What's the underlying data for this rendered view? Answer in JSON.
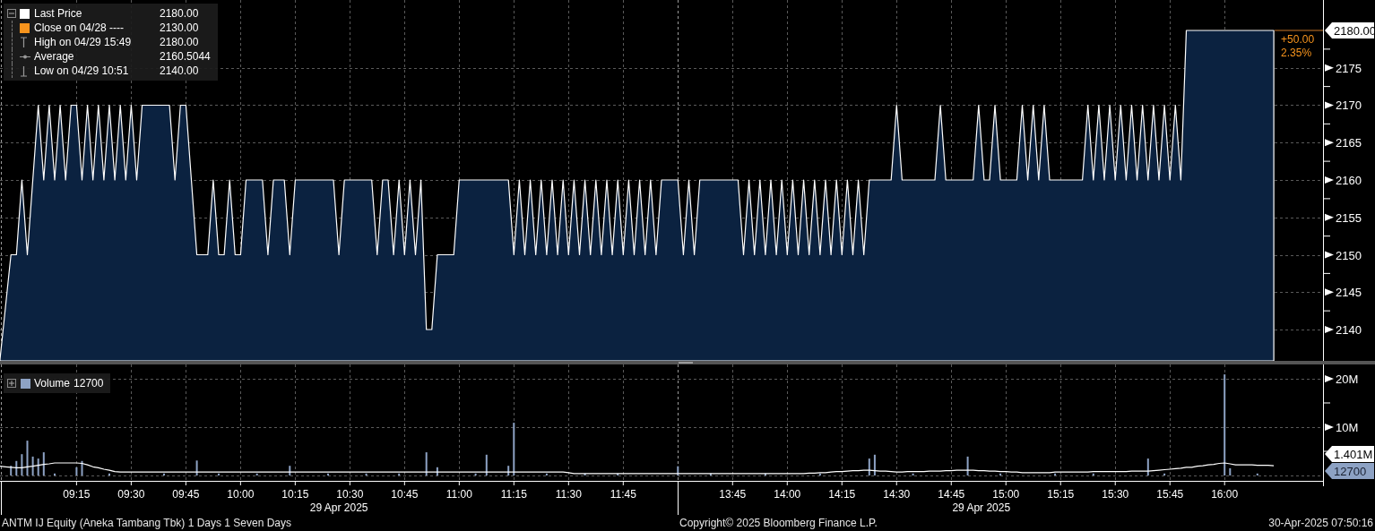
{
  "price_chart": {
    "legend": {
      "items": [
        {
          "kind": "swatch",
          "label": "Last Price",
          "value": "2180.00",
          "color": "#ffffff"
        },
        {
          "kind": "swatch",
          "label": "Close on 04/28 ----",
          "value": "2130.00",
          "color": "#f7941d"
        },
        {
          "kind": "high",
          "label": "High on 04/29 15:49",
          "value": "2180.00"
        },
        {
          "kind": "average",
          "label": "Average",
          "value": "2160.5044"
        },
        {
          "kind": "low",
          "label": "Low on 04/29 10:51",
          "value": "2140.00"
        }
      ]
    },
    "last_price_flag": "2180.00",
    "change": "+50.00",
    "change_percent": "2.35%",
    "chart_data": {
      "type": "area",
      "grid": true,
      "ylim": [
        2135.81,
        2184.07
      ],
      "yticks": [
        2140,
        2145,
        2150,
        2155,
        2160,
        2165,
        2170,
        2175
      ],
      "categories": [
        null,
        null,
        null,
        null,
        null,
        null,
        null,
        null,
        null,
        null,
        null,
        null,
        null,
        null,
        null,
        null,
        null,
        null,
        null,
        null,
        null,
        null,
        null,
        null,
        null,
        null,
        null,
        null,
        null,
        null,
        null,
        null,
        null,
        null,
        null,
        null,
        null,
        null,
        null,
        null,
        null,
        null,
        null,
        null,
        null,
        null,
        null,
        null,
        null,
        null,
        null,
        null,
        null,
        null,
        null,
        null,
        null,
        null,
        null,
        null,
        null,
        null,
        null,
        null,
        null,
        null,
        null,
        null,
        null,
        null,
        null,
        null,
        null,
        null,
        null,
        null,
        null,
        null,
        null,
        null,
        null,
        null,
        null,
        null,
        null,
        null,
        null,
        null,
        null,
        null,
        null,
        null,
        null,
        null,
        null,
        null,
        null,
        null,
        null,
        null,
        null,
        null,
        null,
        null,
        null,
        null,
        null,
        null,
        null,
        null,
        null,
        null,
        null,
        null,
        null,
        null,
        null,
        null,
        null,
        null,
        null,
        null,
        null,
        null,
        null,
        null,
        null,
        null,
        null,
        null,
        null,
        null,
        null,
        null,
        null,
        null,
        null,
        null,
        null,
        null,
        null,
        null,
        null,
        null,
        null,
        null,
        null,
        null,
        null,
        null,
        null,
        null,
        null,
        null,
        null,
        null,
        null,
        null,
        null,
        null,
        null,
        null,
        null,
        null,
        null,
        null,
        null,
        null,
        null,
        null,
        null,
        null,
        null,
        null,
        null,
        null,
        null,
        null,
        null,
        null,
        null,
        null,
        null,
        null,
        null,
        null,
        null,
        null,
        null,
        null,
        null,
        null,
        null,
        null,
        null,
        null,
        null,
        null,
        null,
        null,
        null,
        null,
        null,
        null,
        null,
        null,
        null,
        null,
        null,
        null,
        null,
        null,
        null,
        null,
        null,
        null,
        null,
        null,
        null,
        null,
        null,
        null,
        null,
        null,
        null,
        null,
        null,
        null,
        null,
        null,
        null,
        null,
        null,
        null
      ],
      "series": [
        {
          "values": [
            2136,
            2143,
            2150,
            2150,
            2160,
            2150,
            2160,
            2170,
            2160,
            2170,
            2160,
            2170,
            2160,
            2170,
            2170,
            2160,
            2170,
            2160,
            2170,
            2160,
            2170,
            2160,
            2170,
            2160,
            2170,
            2160,
            2170,
            2170,
            2170,
            2170,
            2170,
            2170,
            2160,
            2170,
            2170,
            2160,
            2150,
            2150,
            2150,
            2160,
            2150,
            2150,
            2160,
            2150,
            2150,
            2160,
            2160,
            2160,
            2160,
            2150,
            2160,
            2160,
            2160,
            2150,
            2160,
            2160,
            2160,
            2160,
            2160,
            2160,
            2160,
            2160,
            2150,
            2160,
            2160,
            2160,
            2160,
            2160,
            2160,
            2150,
            2160,
            2160,
            2150,
            2160,
            2150,
            2160,
            2150,
            2160,
            2140,
            2140,
            2150,
            2150,
            2150,
            2150,
            2160,
            2160,
            2160,
            2160,
            2160,
            2160,
            2160,
            2160,
            2160,
            2160,
            2150,
            2160,
            2150,
            2160,
            2150,
            2160,
            2150,
            2160,
            2150,
            2160,
            2150,
            2160,
            2150,
            2160,
            2150,
            2160,
            2150,
            2160,
            2150,
            2160,
            2150,
            2160,
            2150,
            2160,
            2150,
            2160,
            2150,
            2160,
            2160,
            2160,
            2160,
            2150,
            2160,
            2150,
            2160,
            2160,
            2160,
            2160,
            2160,
            2160,
            2160,
            2160,
            2150,
            2160,
            2150,
            2160,
            2150,
            2160,
            2150,
            2160,
            2150,
            2160,
            2150,
            2160,
            2150,
            2160,
            2150,
            2160,
            2150,
            2160,
            2150,
            2160,
            2150,
            2160,
            2150,
            2160,
            2160,
            2160,
            2160,
            2160,
            2170,
            2160,
            2160,
            2160,
            2160,
            2160,
            2160,
            2160,
            2170,
            2160,
            2160,
            2160,
            2160,
            2160,
            2160,
            2170,
            2160,
            2160,
            2170,
            2160,
            2160,
            2160,
            2160,
            2170,
            2160,
            2170,
            2160,
            2170,
            2160,
            2160,
            2160,
            2160,
            2160,
            2160,
            2160,
            2170,
            2160,
            2170,
            2160,
            2170,
            2160,
            2170,
            2160,
            2170,
            2160,
            2170,
            2160,
            2170,
            2160,
            2170,
            2160,
            2170,
            2160,
            2180,
            2180,
            2180,
            2180,
            2180,
            2180,
            2180,
            2180,
            2180,
            2180,
            2180,
            2180,
            2180,
            2180,
            2180,
            2180,
            2180
          ]
        }
      ]
    }
  },
  "volume_chart": {
    "legend": {
      "label": "Volume",
      "value": "12700",
      "color": "#8da2c4"
    },
    "flags": [
      {
        "kind": "average",
        "text": "1.401M"
      },
      {
        "kind": "last",
        "text": "12700"
      }
    ],
    "chart_data": {
      "type": "bar",
      "grid": true,
      "ylim": [
        -1110000,
        22960000
      ],
      "yticks": [
        {
          "value": 10000000,
          "label": "10M"
        },
        {
          "value": 20000000,
          "label": "20M"
        }
      ],
      "categories": [
        null,
        null,
        null,
        null,
        null,
        null,
        null,
        null,
        null,
        null,
        null,
        null,
        null,
        null,
        "09:15",
        null,
        null,
        null,
        null,
        null,
        null,
        null,
        null,
        null,
        "09:30",
        null,
        null,
        null,
        null,
        null,
        null,
        null,
        null,
        null,
        "09:45",
        null,
        null,
        null,
        null,
        null,
        null,
        null,
        null,
        null,
        "10:00",
        null,
        null,
        null,
        null,
        null,
        null,
        null,
        null,
        null,
        "10:15",
        null,
        null,
        null,
        null,
        null,
        null,
        null,
        null,
        null,
        "10:30",
        null,
        null,
        null,
        null,
        null,
        null,
        null,
        null,
        null,
        "10:45",
        null,
        null,
        null,
        null,
        null,
        null,
        null,
        null,
        null,
        "11:00",
        null,
        null,
        null,
        null,
        null,
        null,
        null,
        null,
        null,
        "11:15",
        null,
        null,
        null,
        null,
        null,
        null,
        null,
        null,
        null,
        "11:30",
        null,
        null,
        null,
        null,
        null,
        null,
        null,
        null,
        null,
        "11:45",
        null,
        null,
        null,
        null,
        null,
        null,
        null,
        null,
        null,
        null,
        null,
        null,
        null,
        null,
        null,
        null,
        null,
        null,
        null,
        "13:45",
        null,
        null,
        null,
        null,
        null,
        null,
        null,
        null,
        null,
        "14:00",
        null,
        null,
        null,
        null,
        null,
        null,
        null,
        null,
        null,
        "14:15",
        null,
        null,
        null,
        null,
        null,
        null,
        null,
        null,
        null,
        "14:30",
        null,
        null,
        null,
        null,
        null,
        null,
        null,
        null,
        null,
        "14:45",
        null,
        null,
        null,
        null,
        null,
        null,
        null,
        null,
        null,
        "15:00",
        null,
        null,
        null,
        null,
        null,
        null,
        null,
        null,
        null,
        "15:15",
        null,
        null,
        null,
        null,
        null,
        null,
        null,
        null,
        null,
        "15:30",
        null,
        null,
        null,
        null,
        null,
        null,
        null,
        null,
        null,
        "15:45",
        null,
        null,
        null,
        null,
        null,
        null,
        null,
        null,
        null,
        "16:00",
        null,
        null,
        null,
        null,
        null,
        null,
        null,
        null,
        null
      ],
      "series": [
        {
          "color": "#8da2c4",
          "values": [
            null,
            null,
            2000000,
            3000000,
            4400000,
            7200000,
            3900000,
            3500000,
            4800000,
            null,
            400000,
            null,
            null,
            null,
            1700000,
            3000000,
            null,
            null,
            null,
            null,
            400000,
            null,
            null,
            null,
            null,
            null,
            null,
            null,
            null,
            null,
            400000,
            null,
            null,
            null,
            null,
            null,
            3100000,
            null,
            null,
            null,
            400000,
            null,
            null,
            null,
            null,
            null,
            null,
            400000,
            null,
            null,
            null,
            null,
            null,
            2000000,
            null,
            null,
            null,
            null,
            null,
            null,
            400000,
            null,
            null,
            null,
            null,
            null,
            null,
            400000,
            null,
            null,
            null,
            null,
            null,
            400000,
            null,
            null,
            null,
            null,
            4800000,
            null,
            1700000,
            null,
            null,
            null,
            null,
            null,
            null,
            400000,
            null,
            4300000,
            null,
            null,
            null,
            2000000,
            10900000,
            null,
            null,
            null,
            null,
            null,
            400000,
            null,
            null,
            null,
            null,
            null,
            null,
            400000,
            null,
            null,
            null,
            null,
            null,
            400000,
            null,
            null,
            null,
            null,
            null,
            null,
            null,
            null,
            null,
            null,
            1900000,
            null,
            null,
            null,
            null,
            null,
            400000,
            null,
            null,
            null,
            null,
            null,
            null,
            null,
            null,
            null,
            400000,
            null,
            null,
            null,
            null,
            null,
            null,
            null,
            null,
            null,
            400000,
            null,
            null,
            null,
            null,
            null,
            null,
            null,
            null,
            3500000,
            4300000,
            null,
            null,
            null,
            null,
            null,
            null,
            400000,
            null,
            null,
            null,
            null,
            null,
            null,
            null,
            null,
            null,
            3900000,
            null,
            null,
            null,
            null,
            null,
            400000,
            null,
            null,
            null,
            null,
            null,
            null,
            null,
            null,
            null,
            400000,
            null,
            null,
            null,
            null,
            null,
            null,
            400000,
            null,
            null,
            null,
            null,
            null,
            null,
            null,
            null,
            null,
            3500000,
            null,
            null,
            400000,
            null,
            null,
            null,
            null,
            null,
            null,
            null,
            null,
            null,
            null,
            20900000,
            1500000,
            null,
            null,
            null,
            null,
            400000,
            null,
            null,
            null
          ]
        },
        {
          "type": "line",
          "color": "#ffffff",
          "values": [
            1900000,
            1800000,
            1700000,
            1600000,
            1600000,
            1800000,
            1900000,
            2100000,
            2300000,
            2400000,
            2600000,
            2600000,
            2600000,
            2600000,
            2600000,
            2500000,
            2200000,
            1800000,
            1600000,
            1300000,
            1100000,
            800000,
            700000,
            700000,
            700000,
            700000,
            700000,
            700000,
            700000,
            700000,
            700000,
            700000,
            700000,
            700000,
            700000,
            700000,
            700000,
            700000,
            700000,
            700000,
            700000,
            700000,
            700000,
            700000,
            700000,
            700000,
            700000,
            700000,
            700000,
            700000,
            700000,
            700000,
            700000,
            700000,
            700000,
            700000,
            700000,
            700000,
            700000,
            700000,
            700000,
            700000,
            700000,
            700000,
            700000,
            700000,
            700000,
            700000,
            700000,
            700000,
            700000,
            700000,
            700000,
            700000,
            700000,
            700000,
            700000,
            700000,
            700000,
            700000,
            700000,
            700000,
            700000,
            700000,
            700000,
            700000,
            700000,
            700000,
            700000,
            700000,
            700000,
            700000,
            700000,
            700000,
            700000,
            700000,
            700000,
            700000,
            700000,
            700000,
            700000,
            700000,
            700000,
            700000,
            600000,
            400000,
            400000,
            400000,
            400000,
            400000,
            400000,
            400000,
            400000,
            400000,
            400000,
            400000,
            400000,
            400000,
            400000,
            400000,
            400000,
            400000,
            400000,
            400000,
            400000,
            400000,
            400000,
            400000,
            400000,
            400000,
            400000,
            400000,
            400000,
            400000,
            400000,
            400000,
            400000,
            400000,
            400000,
            400000,
            400000,
            400000,
            400000,
            400000,
            400000,
            400000,
            400000,
            400000,
            500000,
            500000,
            600000,
            600000,
            700000,
            800000,
            800000,
            900000,
            1000000,
            1000000,
            1100000,
            1100000,
            1000000,
            900000,
            900000,
            800000,
            700000,
            700000,
            800000,
            800000,
            800000,
            800000,
            900000,
            900000,
            900000,
            1000000,
            1000000,
            1100000,
            1100000,
            1100000,
            1100000,
            1000000,
            1000000,
            900000,
            900000,
            800000,
            800000,
            700000,
            700000,
            600000,
            600000,
            600000,
            600000,
            600000,
            600000,
            700000,
            700000,
            700000,
            700000,
            700000,
            700000,
            700000,
            800000,
            800000,
            800000,
            800000,
            800000,
            800000,
            800000,
            900000,
            900000,
            900000,
            900000,
            1000000,
            1100000,
            1200000,
            1300000,
            1400000,
            1500000,
            1700000,
            1700000,
            1900000,
            2000000,
            2200000,
            2300000,
            2500000,
            2600000,
            2400000,
            2200000,
            2200000,
            2200000,
            2200000,
            2100000,
            2100000,
            2100000,
            2000000
          ]
        }
      ]
    }
  },
  "time_axis": {
    "date_labels": [
      "29 Apr 2025",
      "29 Apr 2025"
    ]
  },
  "footer": {
    "left": "ANTM IJ Equity (Aneka Tambang Tbk) 1 Days 1 Seven Days",
    "center": "Copyright© 2025 Bloomberg Finance L.P.",
    "right": "30-Apr-2025 07:50:16"
  }
}
